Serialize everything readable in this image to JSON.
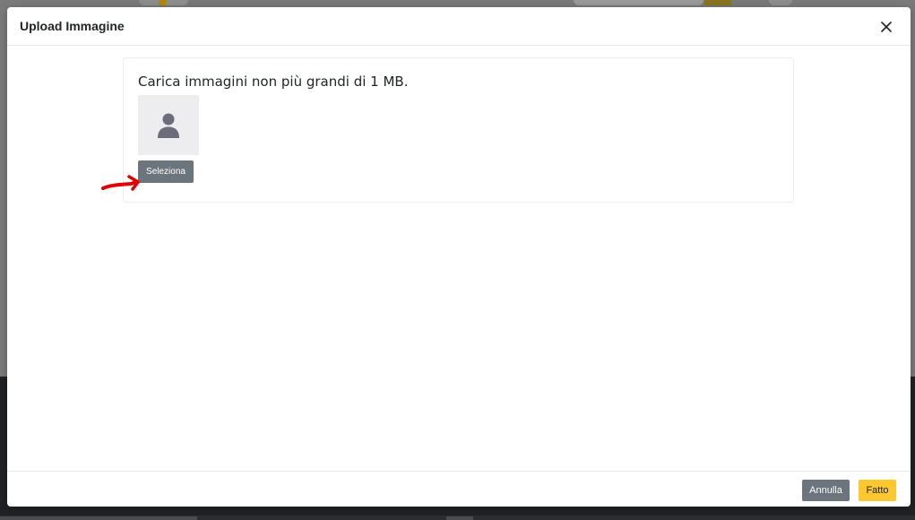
{
  "modal": {
    "title": "Upload Immagine",
    "close_icon": "close-icon"
  },
  "upload": {
    "hint": "Carica immagini non più grandi di 1 MB.",
    "placeholder_icon": "user-avatar-icon",
    "select_label": "Seleziona"
  },
  "annotation": {
    "arrow_color": "#e00000"
  },
  "footer": {
    "cancel_label": "Annulla",
    "done_label": "Fatto"
  },
  "colors": {
    "secondary": "#6c757d",
    "warning": "#fdc72f",
    "avatar_bg": "#ededf0",
    "avatar_icon": "#6c6c7a"
  }
}
